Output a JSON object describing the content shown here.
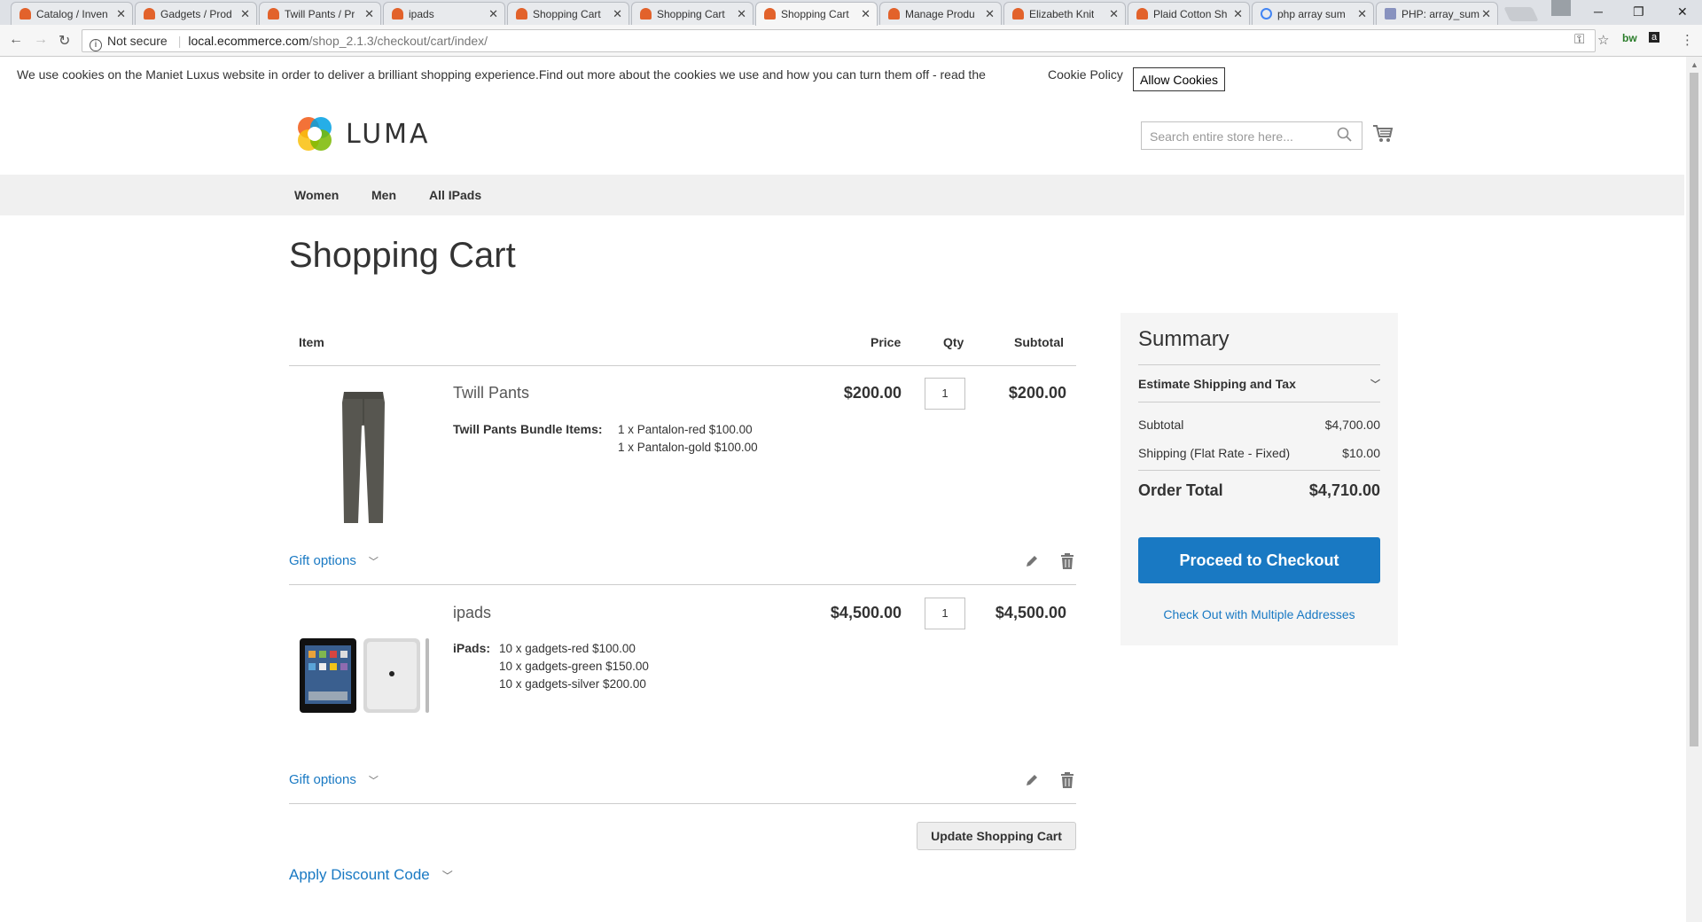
{
  "browser": {
    "tabs": [
      {
        "title": "Catalog / Inven",
        "icon": "magento-icon",
        "active": false
      },
      {
        "title": "Gadgets / Prod",
        "icon": "magento-icon",
        "active": false
      },
      {
        "title": "Twill Pants / Pr",
        "icon": "magento-icon",
        "active": false
      },
      {
        "title": "ipads",
        "icon": "magento-icon",
        "active": false
      },
      {
        "title": "Shopping Cart",
        "icon": "magento-icon",
        "active": false
      },
      {
        "title": "Shopping Cart",
        "icon": "magento-icon",
        "active": false
      },
      {
        "title": "Shopping Cart",
        "icon": "magento-icon",
        "active": true
      },
      {
        "title": "Manage Produ",
        "icon": "magento-icon",
        "active": false
      },
      {
        "title": "Elizabeth Knit",
        "icon": "magento-icon",
        "active": false
      },
      {
        "title": "Plaid Cotton Sh",
        "icon": "magento-icon",
        "active": false
      },
      {
        "title": "php array sum",
        "icon": "google-icon",
        "active": false
      },
      {
        "title": "PHP: array_sum",
        "icon": "php-icon",
        "active": false
      }
    ],
    "security_label": "Not secure",
    "url_host": "local.ecommerce.com",
    "url_path": "/shop_2.1.3/checkout/cart/index/"
  },
  "cookie": {
    "text": "We use cookies on the Maniet Luxus website in order to deliver a brilliant shopping experience.Find out more about the cookies we use and how you can turn them off - read the",
    "link": "Cookie Policy",
    "button": "Allow Cookies"
  },
  "header": {
    "logo_text": "LUMA",
    "search_placeholder": "Search entire store here..."
  },
  "nav": {
    "items": [
      "Women",
      "Men",
      "All IPads"
    ]
  },
  "page_title": "Shopping Cart",
  "cart": {
    "columns": {
      "item": "Item",
      "price": "Price",
      "qty": "Qty",
      "subtotal": "Subtotal"
    },
    "items": [
      {
        "name": "Twill Pants",
        "price": "$200.00",
        "qty": "1",
        "subtotal": "$200.00",
        "options_label": "Twill Pants Bundle Items:",
        "options": [
          "1 x Pantalon-red $100.00",
          "1 x Pantalon-gold $100.00"
        ],
        "gift_label": "Gift options"
      },
      {
        "name": "ipads",
        "price": "$4,500.00",
        "qty": "1",
        "subtotal": "$4,500.00",
        "options_label": "iPads:",
        "options": [
          "10 x gadgets-red $100.00",
          "10 x gadgets-green $150.00",
          "10 x gadgets-silver $200.00"
        ],
        "gift_label": "Gift options"
      }
    ],
    "update_button": "Update Shopping Cart",
    "discount_label": "Apply Discount Code"
  },
  "summary": {
    "title": "Summary",
    "estimate_label": "Estimate Shipping and Tax",
    "subtotal_label": "Subtotal",
    "subtotal_value": "$4,700.00",
    "shipping_label": "Shipping (Flat Rate - Fixed)",
    "shipping_value": "$10.00",
    "total_label": "Order Total",
    "total_value": "$4,710.00",
    "checkout_button": "Proceed to Checkout",
    "multi_link": "Check Out with Multiple Addresses"
  },
  "colors": {
    "accent": "#1979c3",
    "nav_bg": "#f0f0f0",
    "summary_bg": "#f5f5f5"
  }
}
